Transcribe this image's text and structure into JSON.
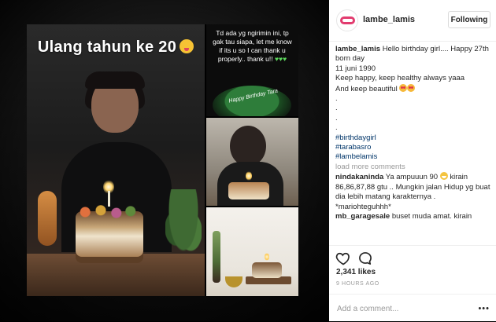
{
  "post": {
    "image_caption_text": "Ulang tahun ke 20",
    "story_text": "Td ada yg ngirimin ini, tp gak tau siapa, let me know if its u so I can thank u properly.. thank u!!",
    "story_hearts": "♥♥♥",
    "story_cake_text": "Happy Birthday Tara"
  },
  "header": {
    "username": "lambe_lamis",
    "follow_label": "Following"
  },
  "caption": {
    "username": "lambe_lamis",
    "line1": "Hello birthday girl.... Happy 27th born day",
    "line2": "11 juni 1990",
    "line3": "Keep happy, keep healthy always yaaa",
    "line4": "And keep beautiful",
    "dots": [
      ".",
      ".",
      ".",
      "."
    ],
    "hashtags": [
      "#birthdaygirl",
      "#tarabasro",
      "#lambelamis"
    ]
  },
  "load_more": "load more comments",
  "comments": [
    {
      "username": "nindakaninda",
      "text_a": "Ya ampuuun 90",
      "text_b": "kirain 86,86,87,88 gtu .. Mungkin jalan Hidup yg buat dia lebih matang karakternya . *mariohteguhhh*"
    },
    {
      "username": "mb_garagesale",
      "text_a": "buset muda amat. kirain",
      "text_b": ""
    }
  ],
  "likes": "2,341 likes",
  "time": "9 HOURS AGO",
  "add_comment_placeholder": "Add a comment...",
  "more_dots": "•••",
  "colors": {
    "link": "#003569",
    "muted": "#999999",
    "text": "#262626"
  }
}
